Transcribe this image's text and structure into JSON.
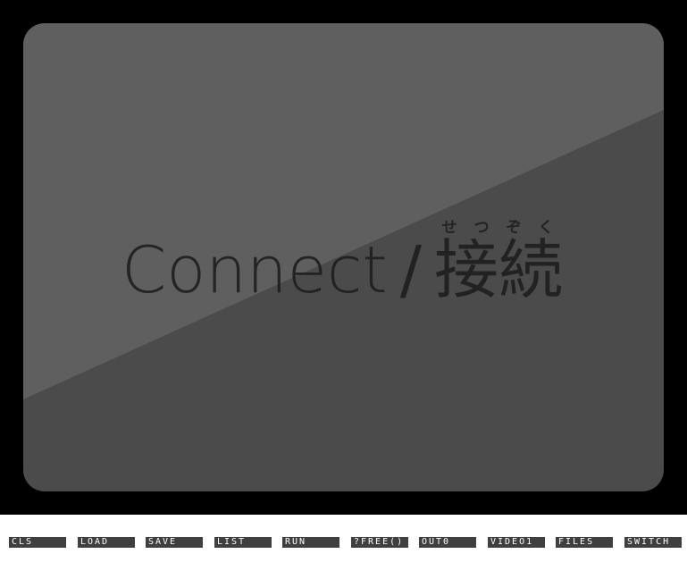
{
  "screen": {
    "connect": {
      "text_en": "Connect",
      "separator": "/",
      "text_ja": "接続",
      "reading": "せつぞく"
    },
    "colors": {
      "frame": "#000000",
      "panel_dark": "#4b4b4b",
      "panel_light": "#5f5f5f",
      "text": "#1f1f1f"
    }
  },
  "function_keys": [
    {
      "label": "CLS"
    },
    {
      "label": "LOAD"
    },
    {
      "label": "SAVE"
    },
    {
      "label": "LIST"
    },
    {
      "label": "RUN"
    },
    {
      "label": "?FREE()"
    },
    {
      "label": "OUT0"
    },
    {
      "label": "VIDEO1"
    },
    {
      "label": "FILES"
    },
    {
      "label": "SWITCH"
    }
  ]
}
